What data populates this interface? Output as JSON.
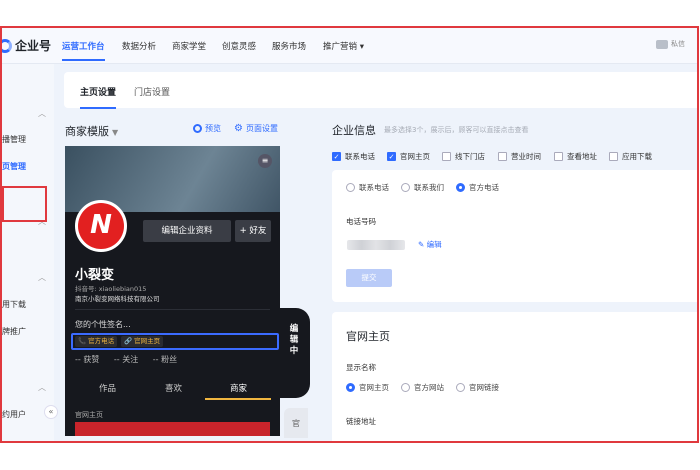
{
  "app": {
    "logo_text": "企业号"
  },
  "topnav": {
    "items": [
      "运营工作台",
      "数据分析",
      "商家学堂",
      "创意灵感",
      "服务市场",
      "推广营销 ▾"
    ],
    "active_index": 0,
    "message_label": "私信"
  },
  "sidebar": {
    "items": [
      "直播管理",
      "主页管理",
      "应用下载",
      "品牌推广",
      "的约用户"
    ],
    "active_item": "主页管理",
    "collapse_icon": "«"
  },
  "tabs": [
    "主页设置",
    "门店设置"
  ],
  "template": {
    "title": "商家模版",
    "preview_label": "预览",
    "page_settings_label": "页面设置"
  },
  "phone": {
    "menu_icon": "≡",
    "avatar_letter": "N",
    "edit_button": "编辑企业资料",
    "add_friend_button": "+ 好友",
    "name": "小裂变",
    "douyin_id": "抖音号: xiaoliebian015",
    "company": "南京小裂变网络科技有限公司",
    "signature": "您的个性签名...",
    "chips": [
      "官方电话",
      "官网主页"
    ],
    "stats": [
      "-- 获赞",
      "-- 关注",
      "-- 粉丝"
    ],
    "tabs": [
      "作品",
      "喜欢",
      "商家"
    ],
    "active_tab": "商家",
    "section_label": "官网主页",
    "popover_text": "编辑中",
    "side_text": "官"
  },
  "company_info": {
    "title": "企业信息",
    "hint": "最多选择3个，展示后，顾客可以直接点击查看",
    "checkboxes": [
      {
        "label": "联系电话",
        "checked": true
      },
      {
        "label": "官网主页",
        "checked": true
      },
      {
        "label": "线下门店",
        "checked": false
      },
      {
        "label": "营业时间",
        "checked": false
      },
      {
        "label": "查看地址",
        "checked": false
      },
      {
        "label": "应用下载",
        "checked": false
      }
    ]
  },
  "contact_card": {
    "radios": [
      {
        "label": "联系电话",
        "selected": false
      },
      {
        "label": "联系我们",
        "selected": false
      },
      {
        "label": "官方电话",
        "selected": true
      }
    ],
    "phone_label": "电话号码",
    "edit_label": "编辑",
    "submit_label": "提交"
  },
  "website_card": {
    "title": "官网主页",
    "display_name_label": "显示名称",
    "radios": [
      {
        "label": "官网主页",
        "selected": true
      },
      {
        "label": "官方网站",
        "selected": false
      },
      {
        "label": "官网链接",
        "selected": false
      }
    ],
    "link_label": "链接地址"
  }
}
